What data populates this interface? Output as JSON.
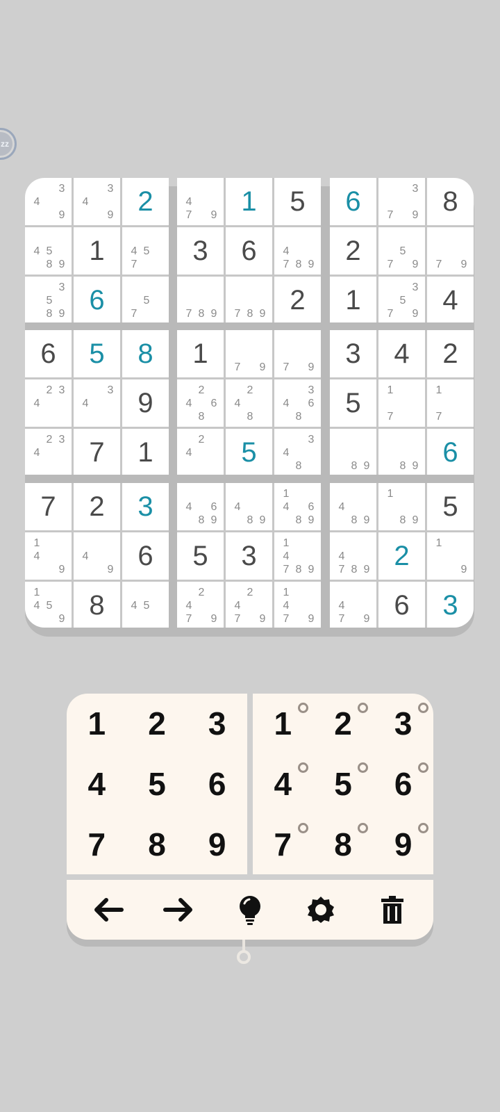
{
  "side_badge": {
    "label": "zz"
  },
  "board": {
    "rows": [
      [
        {
          "notes": [
            4,
            3,
            9
          ]
        },
        {
          "notes": [
            4,
            3,
            9
          ]
        },
        {
          "value": "2",
          "user": true
        },
        {
          "notes": [
            4,
            7,
            9
          ]
        },
        {
          "value": "1",
          "user": true
        },
        {
          "value": "5"
        },
        {
          "value": "6",
          "user": true
        },
        {
          "notes": [
            3,
            7,
            9
          ]
        },
        {
          "value": "8"
        }
      ],
      [
        {
          "notes": [
            4,
            5,
            8,
            9
          ]
        },
        {
          "value": "1"
        },
        {
          "notes": [
            4,
            5,
            7
          ]
        },
        {
          "value": "3"
        },
        {
          "value": "6"
        },
        {
          "notes": [
            4,
            7,
            8,
            9
          ]
        },
        {
          "value": "2"
        },
        {
          "notes": [
            5,
            7,
            9
          ]
        },
        {
          "notes": [
            7,
            9
          ]
        }
      ],
      [
        {
          "notes": [
            3,
            5,
            8,
            9
          ]
        },
        {
          "value": "6",
          "user": true
        },
        {
          "notes": [
            5,
            7
          ]
        },
        {
          "notes": [
            7,
            8,
            9
          ]
        },
        {
          "notes": [
            7,
            8,
            9
          ]
        },
        {
          "value": "2"
        },
        {
          "value": "1"
        },
        {
          "notes": [
            3,
            5,
            7,
            9
          ]
        },
        {
          "value": "4"
        }
      ],
      [
        {
          "value": "6"
        },
        {
          "value": "5",
          "user": true
        },
        {
          "value": "8",
          "user": true
        },
        {
          "value": "1"
        },
        {
          "notes": [
            7,
            9
          ]
        },
        {
          "notes": [
            7,
            9
          ]
        },
        {
          "value": "3"
        },
        {
          "value": "4"
        },
        {
          "value": "2"
        }
      ],
      [
        {
          "notes": [
            2,
            3,
            4
          ]
        },
        {
          "notes": [
            3,
            4
          ]
        },
        {
          "value": "9"
        },
        {
          "notes": [
            2,
            4,
            6,
            8
          ]
        },
        {
          "notes": [
            2,
            4,
            8
          ]
        },
        {
          "notes": [
            3,
            4,
            6,
            8
          ]
        },
        {
          "value": "5"
        },
        {
          "notes": [
            1,
            7
          ]
        },
        {
          "notes": [
            1,
            7
          ]
        }
      ],
      [
        {
          "notes": [
            2,
            3,
            4
          ]
        },
        {
          "value": "7"
        },
        {
          "value": "1"
        },
        {
          "notes": [
            2,
            4
          ]
        },
        {
          "value": "5",
          "user": true
        },
        {
          "notes": [
            3,
            4,
            8
          ]
        },
        {
          "notes": [
            8,
            9
          ]
        },
        {
          "notes": [
            8,
            9
          ]
        },
        {
          "value": "6",
          "user": true
        }
      ],
      [
        {
          "value": "7"
        },
        {
          "value": "2"
        },
        {
          "value": "3",
          "user": true
        },
        {
          "notes": [
            4,
            6,
            8,
            9
          ]
        },
        {
          "notes": [
            4,
            8,
            9
          ]
        },
        {
          "notes": [
            1,
            4,
            6,
            8,
            9
          ]
        },
        {
          "notes": [
            4,
            8,
            9
          ]
        },
        {
          "notes": [
            1,
            8,
            9
          ]
        },
        {
          "value": "5"
        }
      ],
      [
        {
          "notes": [
            1,
            4,
            9
          ]
        },
        {
          "notes": [
            4,
            9
          ]
        },
        {
          "value": "6"
        },
        {
          "value": "5"
        },
        {
          "value": "3"
        },
        {
          "notes": [
            1,
            4,
            7,
            8,
            9
          ]
        },
        {
          "notes": [
            4,
            7,
            8,
            9
          ]
        },
        {
          "value": "2",
          "user": true
        },
        {
          "notes": [
            1,
            9
          ]
        }
      ],
      [
        {
          "notes": [
            1,
            4,
            5,
            9
          ]
        },
        {
          "value": "8"
        },
        {
          "notes": [
            4,
            5
          ]
        },
        {
          "notes": [
            2,
            4,
            7,
            9
          ]
        },
        {
          "notes": [
            2,
            4,
            7,
            9
          ]
        },
        {
          "notes": [
            1,
            4,
            7,
            9
          ]
        },
        {
          "notes": [
            4,
            7,
            9
          ]
        },
        {
          "value": "6"
        },
        {
          "value": "3",
          "user": true
        }
      ]
    ]
  },
  "keypad": {
    "digits": [
      "1",
      "2",
      "3",
      "4",
      "5",
      "6",
      "7",
      "8",
      "9"
    ],
    "note_digits": [
      "1",
      "2",
      "3",
      "4",
      "5",
      "6",
      "7",
      "8",
      "9"
    ]
  },
  "toolbar": {
    "icons": [
      "arrow-left-icon",
      "arrow-right-icon",
      "lightbulb-icon",
      "gear-icon",
      "trash-icon"
    ]
  },
  "colors": {
    "background": "#cfcfcf",
    "given_digit": "#4a4a4a",
    "user_digit": "#1a8fa6",
    "note_digit": "#8a8a8a",
    "pad_bg": "#fdf6ee"
  }
}
